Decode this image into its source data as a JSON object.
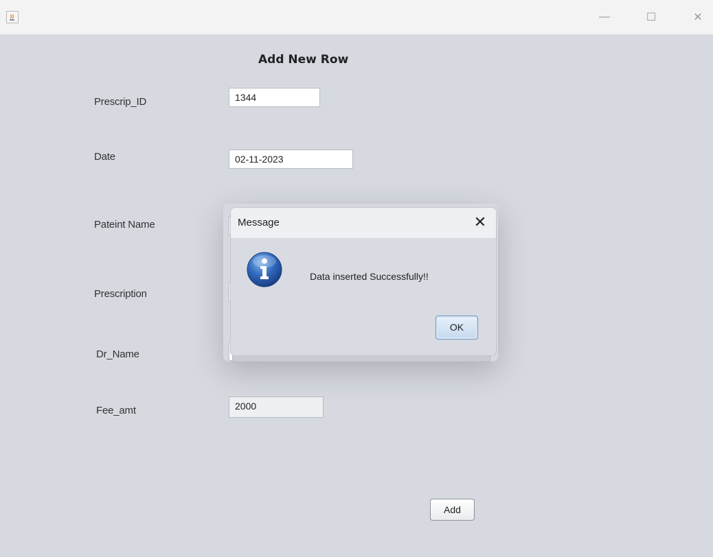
{
  "titlebar": {
    "icons": {
      "app": "java-cup-icon",
      "minimize": "minimize-icon",
      "maximize": "maximize-icon",
      "close": "close-icon"
    },
    "minimize_glyph": "—",
    "maximize_glyph": "☐",
    "close_glyph": "✕"
  },
  "form": {
    "heading": "Add New Row",
    "fields": [
      {
        "label": "Prescrip_ID",
        "value": "1344"
      },
      {
        "label": "Date",
        "value": "02-11-2023"
      },
      {
        "label": "Pateint Name",
        "value": ""
      },
      {
        "label": "Prescription",
        "value": ""
      },
      {
        "label": "Dr_Name",
        "value": ""
      },
      {
        "label": "Fee_amt",
        "value": "2000"
      }
    ],
    "add_label": "Add"
  },
  "dialog": {
    "title": "Message",
    "close_glyph": "✕",
    "message": "Data inserted Successfully!!",
    "ok_label": "OK",
    "icon": "info-icon",
    "colors": {
      "icon_blue": "#2a5fae",
      "ok_border": "#6f93bd"
    }
  },
  "colors": {
    "background": "#d6d9e0",
    "titlebar": "#f3f3f3"
  }
}
